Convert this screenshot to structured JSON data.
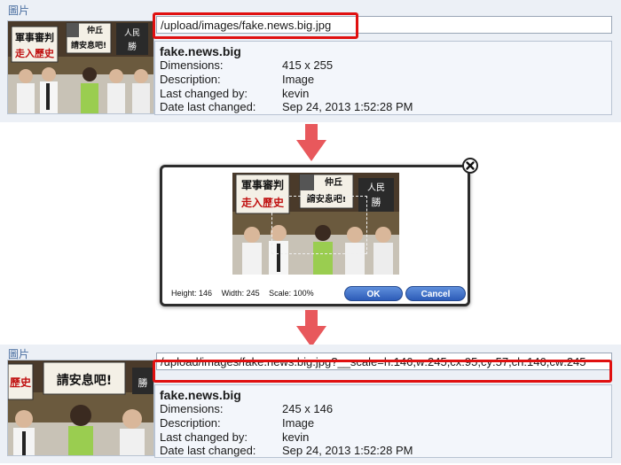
{
  "top": {
    "section_label": "圖片",
    "url": "/upload/images/fake.news.big.jpg",
    "thumb_signs": [
      "軍事審判",
      "走入歷史",
      "仲丘",
      "請安息吧!",
      "人民",
      "勝"
    ],
    "file": {
      "name": "fake.news.big",
      "rows": [
        {
          "label": "Dimensions:",
          "value": "415 x 255"
        },
        {
          "label": "Description:",
          "value": "Image"
        },
        {
          "label": "Last changed by:",
          "value": "kevin"
        },
        {
          "label": "Date last changed:",
          "value": "Sep 24, 2013 1:52:28 PM"
        }
      ]
    }
  },
  "dialog": {
    "height_text": "Height: 146",
    "width_text": "Width: 245",
    "scale_text": "Scale: 100%",
    "ok_label": "OK",
    "cancel_label": "Cancel",
    "image_signs": [
      "軍事審判",
      "走入歷史",
      "仲丘",
      "請安息吧!",
      "人民",
      "勝"
    ]
  },
  "bottom": {
    "section_label": "圖片",
    "url": "/upload/images/fake.news.big.jpg?__scale=h:146,w:245,cx:95,cy:57,ch:146,cw:245",
    "thumb_signs": [
      "歷史",
      "請安息吧!",
      "勝"
    ],
    "file": {
      "name": "fake.news.big",
      "rows": [
        {
          "label": "Dimensions:",
          "value": "245 x 146"
        },
        {
          "label": "Description:",
          "value": "Image"
        },
        {
          "label": "Last changed by:",
          "value": "kevin"
        },
        {
          "label": "Date last changed:",
          "value": "Sep 24, 2013 1:52:28 PM"
        }
      ]
    }
  },
  "colors": {
    "highlight": "#e01010",
    "arrow": "#e8585c",
    "button": "#2d5cb8",
    "panel_bg": "#ecf0f6",
    "label": "#4a6ea0"
  }
}
